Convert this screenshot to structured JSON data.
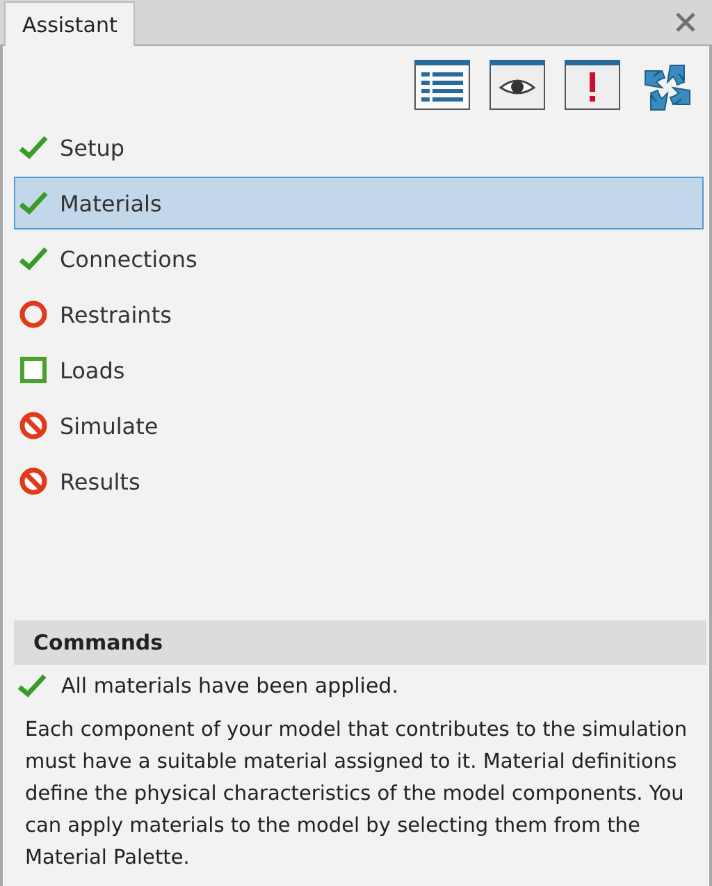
{
  "tab": {
    "label": "Assistant",
    "selected": true
  },
  "steps": [
    {
      "label": "Setup",
      "kind": "done",
      "selected": false
    },
    {
      "label": "Materials",
      "kind": "done",
      "selected": true
    },
    {
      "label": "Connections",
      "kind": "done",
      "selected": false
    },
    {
      "label": "Restraints",
      "kind": "pending",
      "selected": false
    },
    {
      "label": "Loads",
      "kind": "todo",
      "selected": false
    },
    {
      "label": "Simulate",
      "kind": "blocked",
      "selected": false
    },
    {
      "label": "Results",
      "kind": "blocked",
      "selected": false
    }
  ],
  "commands": {
    "title": "Commands",
    "status": {
      "kind": "done",
      "text": "All materials have been applied."
    },
    "description": "Each component of your model that contributes to the simulation must have a suitable material assigned to it. Material definitions define the physical characteristics of the model components. You can apply materials to the model by selecting them from the Material Palette."
  }
}
